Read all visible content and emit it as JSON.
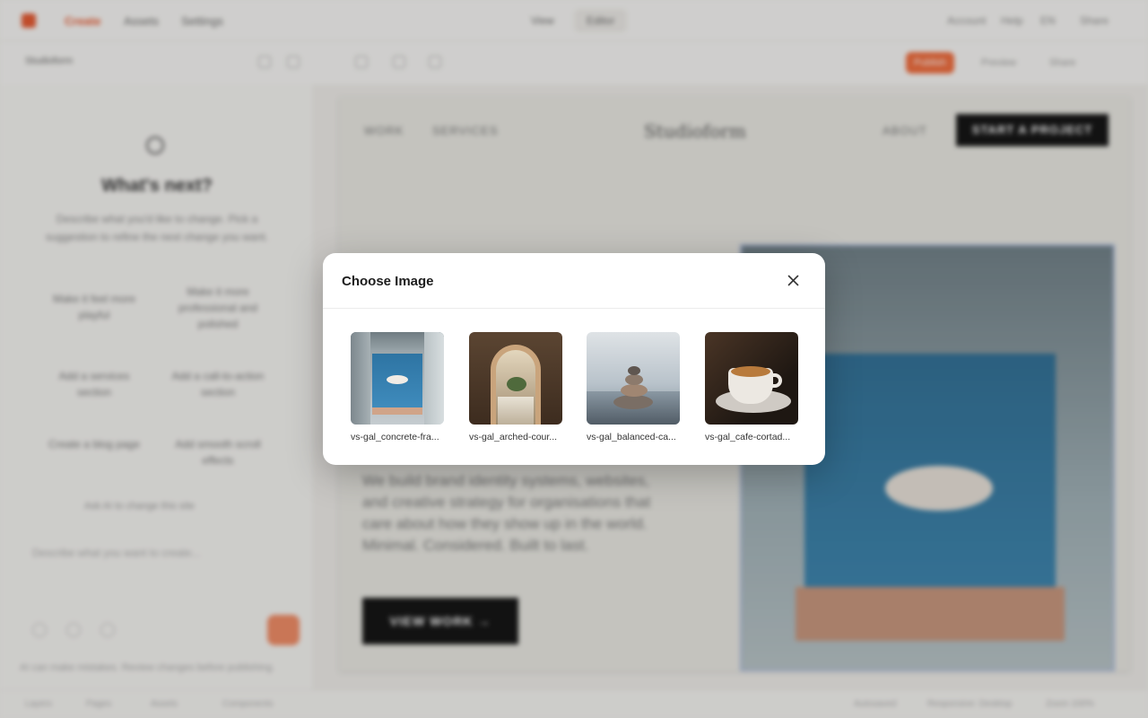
{
  "topbar": {
    "nav": [
      {
        "label": "Create",
        "active": true
      },
      {
        "label": "Assets",
        "active": false
      },
      {
        "label": "Settings",
        "active": false
      }
    ],
    "segments": [
      {
        "label": "View",
        "selected": false
      },
      {
        "label": "Editor",
        "selected": true
      }
    ],
    "right": [
      "Account",
      "Help",
      "EN",
      "Share"
    ]
  },
  "toolbar": {
    "project": "Studioform",
    "publish_label": "Publish",
    "right": [
      "Preview",
      "Share"
    ]
  },
  "sidebar": {
    "heading": "What's next?",
    "description": "Describe what you'd like to change. Pick a suggestion to refine the next change you want.",
    "suggestions": [
      "Make it feel more playful",
      "Make it more professional and polished",
      "Add a services section",
      "Add a call-to-action section",
      "Create a blog page",
      "Add smooth scroll effects"
    ],
    "suggestion_note": "Ask AI to change this site",
    "prompt_placeholder": "Describe what you want to create...",
    "footer": "AI can make mistakes. Review changes before publishing."
  },
  "site": {
    "nav_left": [
      "WORK",
      "SERVICES"
    ],
    "brand": "Studioform",
    "nav_right": "ABOUT",
    "cta": "START A PROJECT",
    "body": "We build brand identity systems, websites, and creative strategy for organisations that care about how they show up in the world. Minimal. Considered. Built to last.",
    "more_label": "VIEW WORK →"
  },
  "statusbar": {
    "left": [
      "Layers",
      "Pages",
      "Assets",
      "Components"
    ],
    "right": [
      "Autosaved",
      "Responsive: Desktop",
      "Zoom 100%"
    ]
  },
  "modal": {
    "title": "Choose Image",
    "images": [
      {
        "file": "vs-gal_concrete-fra...",
        "icon": "concrete-frame-thumbnail"
      },
      {
        "file": "vs-gal_arched-cour...",
        "icon": "arched-courtyard-thumbnail"
      },
      {
        "file": "vs-gal_balanced-ca...",
        "icon": "balanced-cairn-thumbnail"
      },
      {
        "file": "vs-gal_cafe-cortad...",
        "icon": "cafe-cortado-thumbnail"
      }
    ]
  },
  "colors": {
    "accent": "#e4572e",
    "modal_bg": "#ffffff",
    "scrim": "rgba(28,28,28,0.18)"
  }
}
